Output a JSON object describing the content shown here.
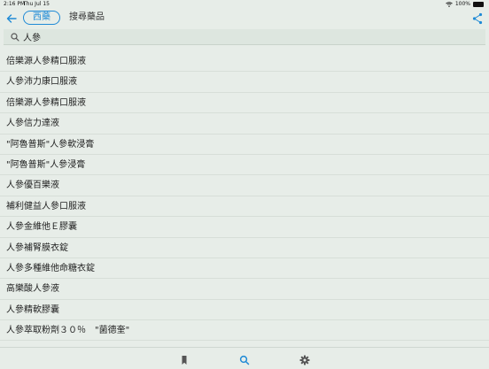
{
  "status_bar": {
    "time": "2:16 PM",
    "date": "Thu Jul 15",
    "battery": "100%"
  },
  "nav": {
    "back_icon": "back-arrow-icon",
    "segment_label": "西藥",
    "title": "搜尋藥品",
    "share_icon": "share-icon"
  },
  "search": {
    "value": "人參",
    "icon": "search-icon"
  },
  "results": [
    "倍樂源人參精口服液",
    "人參沛力康口服液",
    "倍樂源人參精口服液",
    "人參信力達液",
    "\"阿魯普斯\"人參軟浸膏",
    "\"阿魯普斯\"人參浸膏",
    "人參優百樂液",
    "補利健益人參口服液",
    "人參金維他Ｅ膠囊",
    "人參補腎膜衣錠",
    "人參多種維他命糖衣錠",
    "高樂酸人參液",
    "人參精軟膠囊",
    "人參萃取粉劑３０％　\"菌德奎\""
  ],
  "tabs": {
    "bookmarks_icon": "bookmark-icon",
    "search_icon": "search-icon",
    "settings_icon": "gear-icon"
  },
  "colors": {
    "accent": "#1f8ad6",
    "background": "#e7ede8",
    "divider": "#d7ded8"
  }
}
